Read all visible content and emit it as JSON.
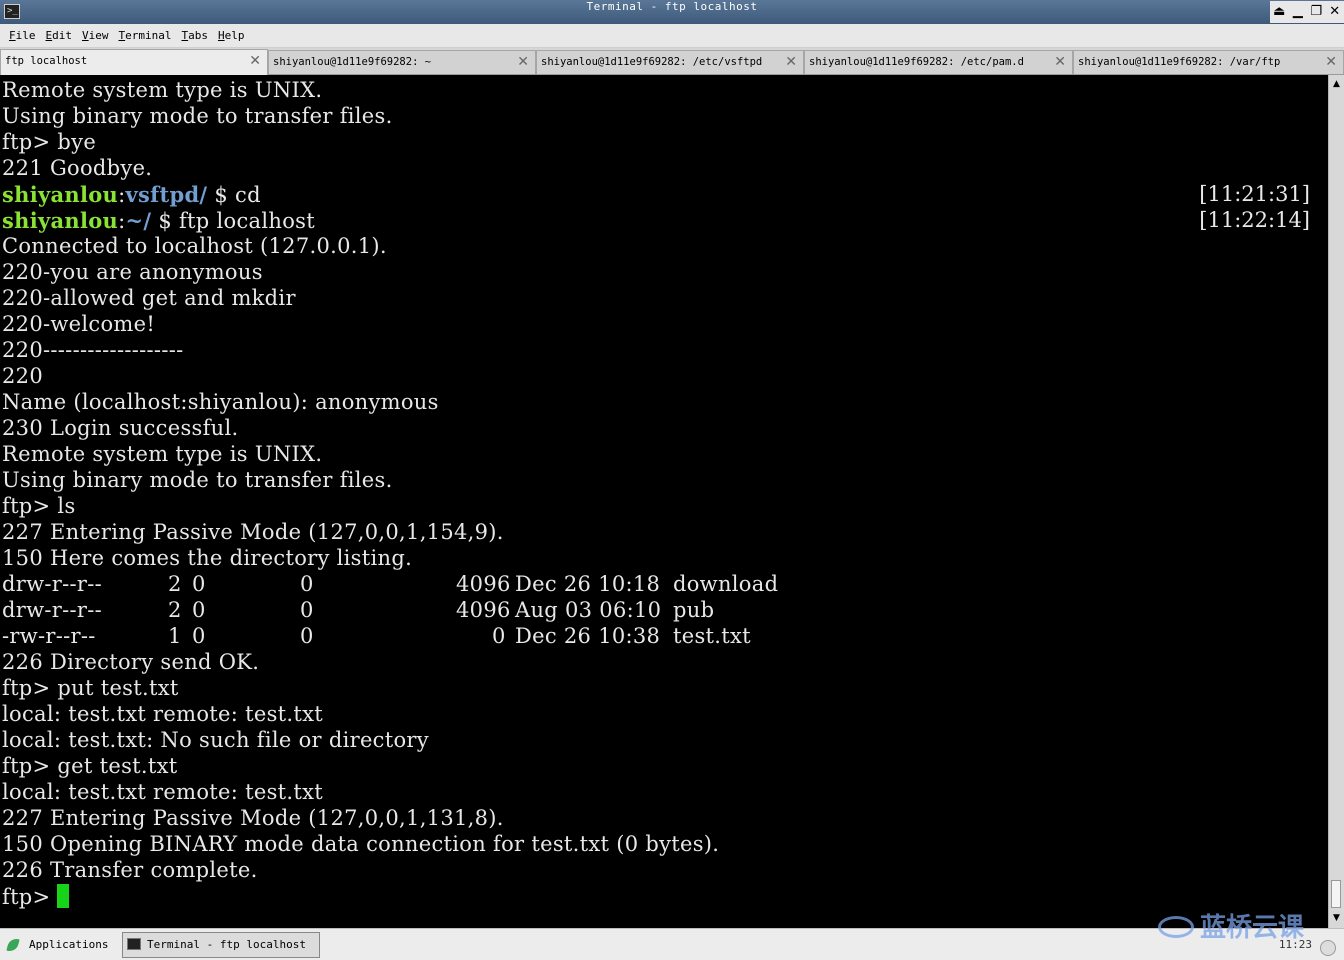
{
  "window": {
    "title": "Terminal - ftp localhost",
    "icon": "terminal-icon",
    "buttons": [
      "maximize-shade-icon",
      "minimize-icon",
      "restore-icon",
      "close-icon"
    ]
  },
  "menubar": {
    "items": [
      {
        "first": "F",
        "rest": "ile"
      },
      {
        "first": "E",
        "rest": "dit"
      },
      {
        "first": "V",
        "rest": "iew"
      },
      {
        "first": "T",
        "rest": "erminal"
      },
      {
        "first": "T",
        "rest": "abs"
      },
      {
        "first": "H",
        "rest": "elp"
      }
    ]
  },
  "tabs": [
    {
      "label": "ftp localhost",
      "active": true
    },
    {
      "label": "shiyanlou@1d11e9f69282: ~",
      "active": false
    },
    {
      "label": "shiyanlou@1d11e9f69282: /etc/vsftpd",
      "active": false
    },
    {
      "label": "shiyanlou@1d11e9f69282: /etc/pam.d",
      "active": false
    },
    {
      "label": "shiyanlou@1d11e9f69282: /var/ftp",
      "active": false
    }
  ],
  "terminal": {
    "lines": [
      "Remote system type is UNIX.",
      "Using binary mode to transfer files.",
      "ftp> bye",
      "221 Goodbye."
    ],
    "prompt1": {
      "user": "shiyanlou",
      "colon": ":",
      "dir": "vsftpd/",
      "cmd": " $ cd",
      "time": "[11:21:31]"
    },
    "prompt2": {
      "user": "shiyanlou",
      "colon": ":",
      "dir": "~/",
      "cmd": " $ ftp localhost",
      "time": "[11:22:14]"
    },
    "session_a": [
      "Connected to localhost (127.0.0.1).",
      "220-you are anonymous",
      "220-allowed get and mkdir",
      "220-welcome!",
      "220-------------------",
      "220",
      "Name (localhost:shiyanlou): anonymous",
      "230 Login successful.",
      "Remote system type is UNIX.",
      "Using binary mode to transfer files.",
      "ftp> ls",
      "227 Entering Passive Mode (127,0,0,1,154,9).",
      "150 Here comes the directory listing."
    ],
    "listing": [
      {
        "perm": "drw-r--r--",
        "links": "2",
        "uid": "0",
        "gid": "0",
        "size": "4096",
        "date": "Dec 26 10:18",
        "name": "download"
      },
      {
        "perm": "drw-r--r--",
        "links": "2",
        "uid": "0",
        "gid": "0",
        "size": "4096",
        "date": "Aug 03 06:10",
        "name": "pub"
      },
      {
        "perm": "-rw-r--r--",
        "links": "1",
        "uid": "0",
        "gid": "0",
        "size": "0",
        "date": "Dec 26 10:38",
        "name": "test.txt"
      }
    ],
    "session_b": [
      "226 Directory send OK.",
      "ftp> put test.txt",
      "local: test.txt remote: test.txt",
      "local: test.txt: No such file or directory",
      "ftp> get test.txt",
      "local: test.txt remote: test.txt",
      "227 Entering Passive Mode (127,0,0,1,131,8).",
      "150 Opening BINARY mode data connection for test.txt (0 bytes).",
      "226 Transfer complete."
    ],
    "current_prompt": "ftp> ",
    "cursor_color": "#18d418"
  },
  "taskbar": {
    "applications_label": "Applications",
    "task_label": "Terminal - ftp localhost",
    "clock": "11:23",
    "watermark": "蓝桥云课"
  },
  "colors": {
    "prompt_user": "#8ae234",
    "prompt_dir": "#729fcf",
    "terminal_bg": "#000000",
    "terminal_fg": "#e8e8e8"
  }
}
